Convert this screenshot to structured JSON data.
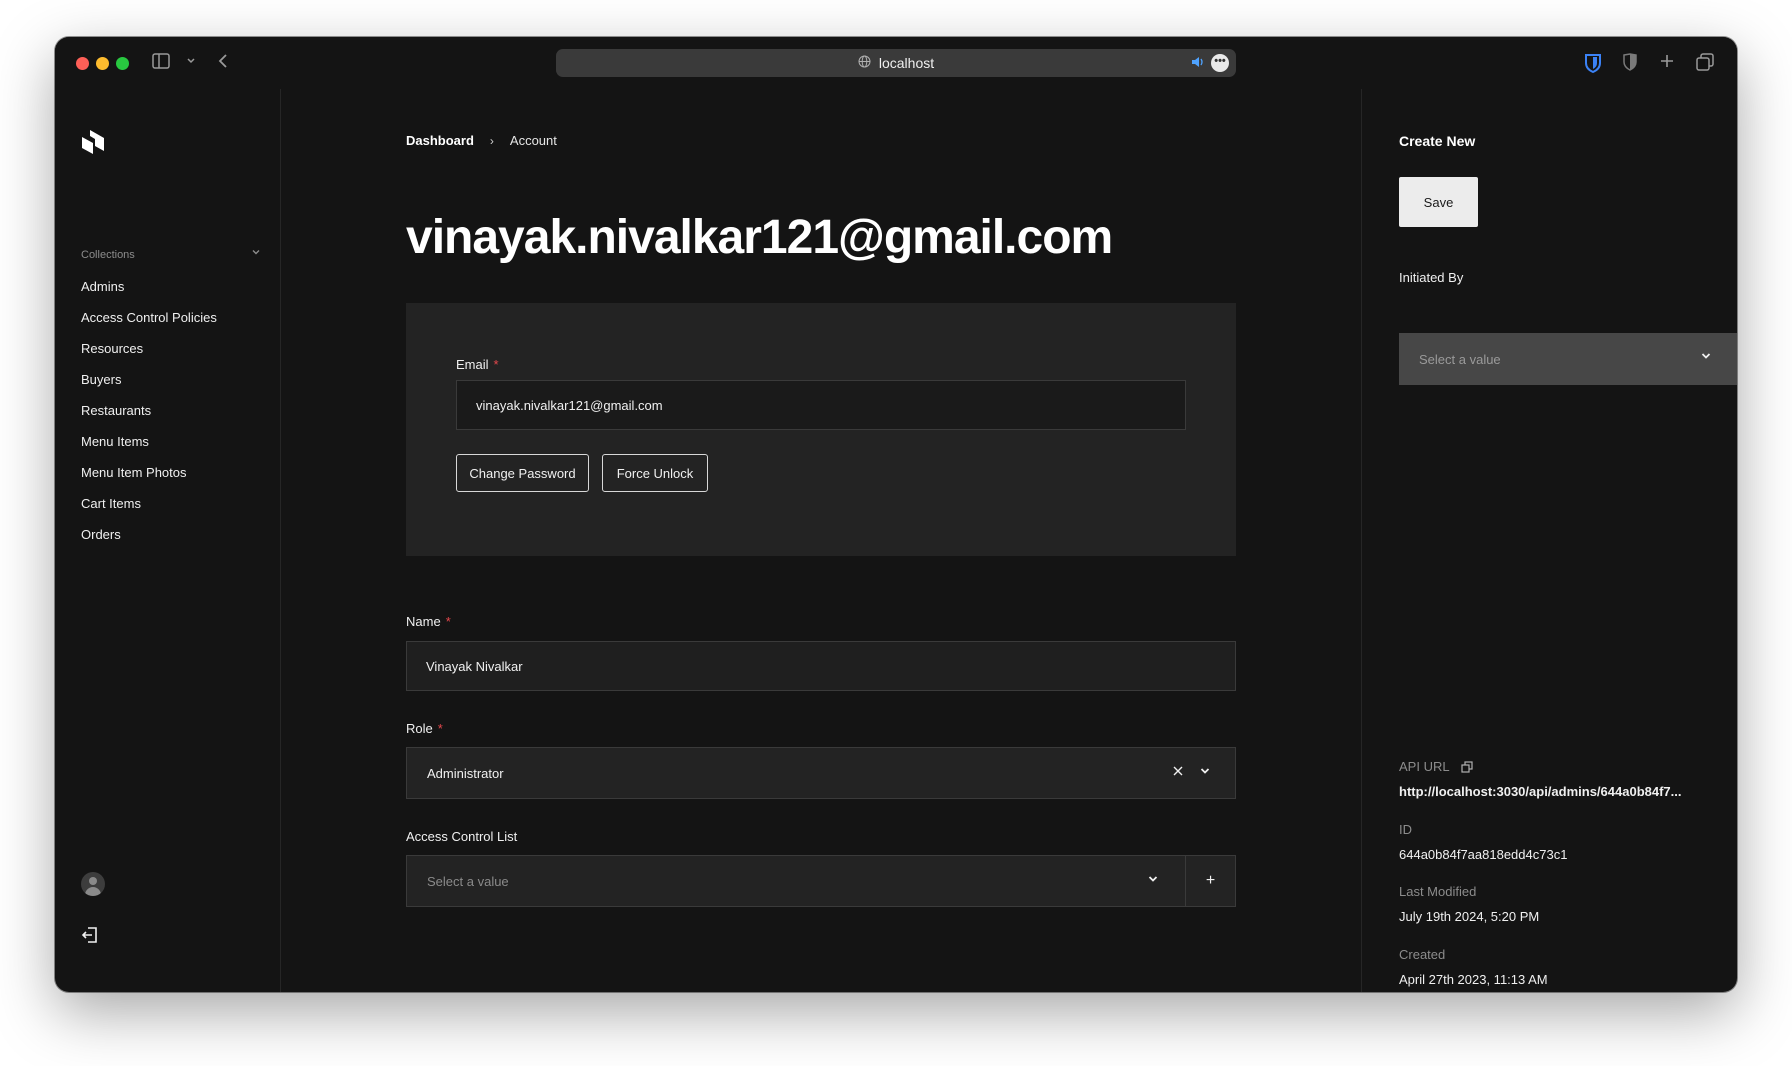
{
  "browser": {
    "url": "localhost"
  },
  "sidebar": {
    "collections_label": "Collections",
    "items": [
      {
        "label": "Admins"
      },
      {
        "label": "Access Control Policies"
      },
      {
        "label": "Resources"
      },
      {
        "label": "Buyers"
      },
      {
        "label": "Restaurants"
      },
      {
        "label": "Menu Items"
      },
      {
        "label": "Menu Item Photos"
      },
      {
        "label": "Cart Items"
      },
      {
        "label": "Orders"
      }
    ]
  },
  "breadcrumb": {
    "home": "Dashboard",
    "separator": "›",
    "current": "Account"
  },
  "page": {
    "title": "vinayak.nivalkar121@gmail.com"
  },
  "auth": {
    "email_label": "Email",
    "required_mark": "*",
    "email_value": "vinayak.nivalkar121@gmail.com",
    "change_password_label": "Change Password",
    "force_unlock_label": "Force Unlock"
  },
  "form": {
    "name_label": "Name",
    "name_value": "Vinayak Nivalkar",
    "role_label": "Role",
    "role_value": "Administrator",
    "acl_label": "Access Control List",
    "acl_placeholder": "Select a value",
    "add_symbol": "+"
  },
  "right_panel": {
    "title": "Create New",
    "save_label": "Save",
    "initiated_by_label": "Initiated By",
    "initiated_by_placeholder": "Select a value",
    "api_url_label": "API URL",
    "api_url_value": "http://localhost:3030/api/admins/644a0b84f7...",
    "id_label": "ID",
    "id_value": "644a0b84f7aa818edd4c73c1",
    "last_modified_label": "Last Modified",
    "last_modified_value": "July 19th 2024, 5:20 PM",
    "created_label": "Created",
    "created_value": "April 27th 2023, 11:13 AM"
  },
  "colors": {
    "background": "#141414",
    "panel": "#232323",
    "required": "#e5484d",
    "url_audio": "#4fa3ff",
    "bitwarden": "#3b82f6"
  }
}
